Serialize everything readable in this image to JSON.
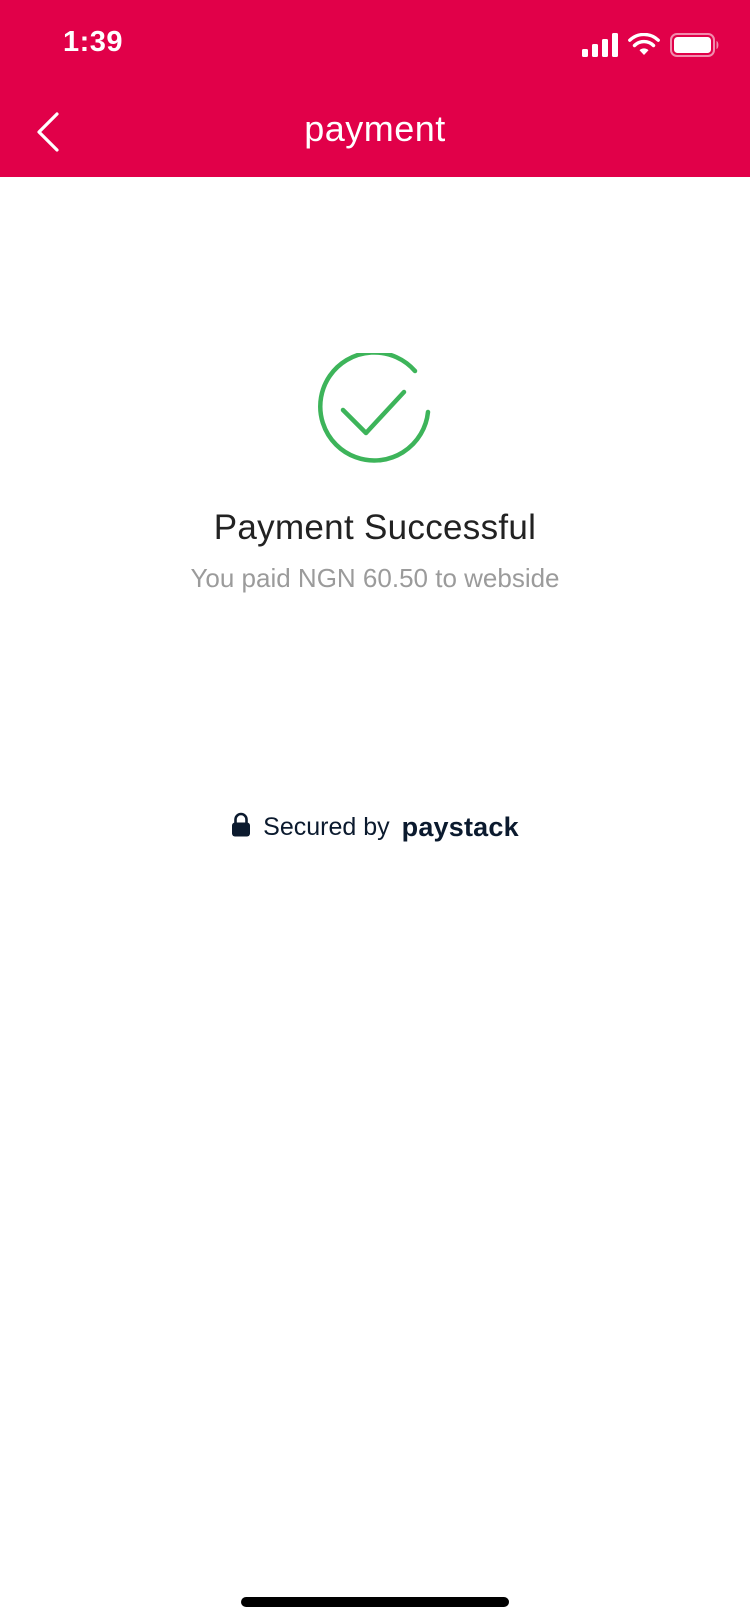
{
  "status_bar": {
    "time": "1:39",
    "icons": [
      "cellular-signal-icon",
      "wifi-icon",
      "battery-icon"
    ]
  },
  "nav": {
    "title": "payment",
    "back_icon": "chevron-left-icon"
  },
  "result": {
    "status_icon": "check-circle-icon",
    "title": "Payment Successful",
    "subtitle": "You paid NGN 60.50 to webside"
  },
  "footer": {
    "lock_icon": "lock-icon",
    "secured_label": "Secured by",
    "brand": "paystack"
  },
  "colors": {
    "header_bg": "#E10049",
    "success_green": "#3DB45A",
    "brand_dark": "#0B1A2E",
    "subtitle_gray": "#9B9B9B"
  }
}
